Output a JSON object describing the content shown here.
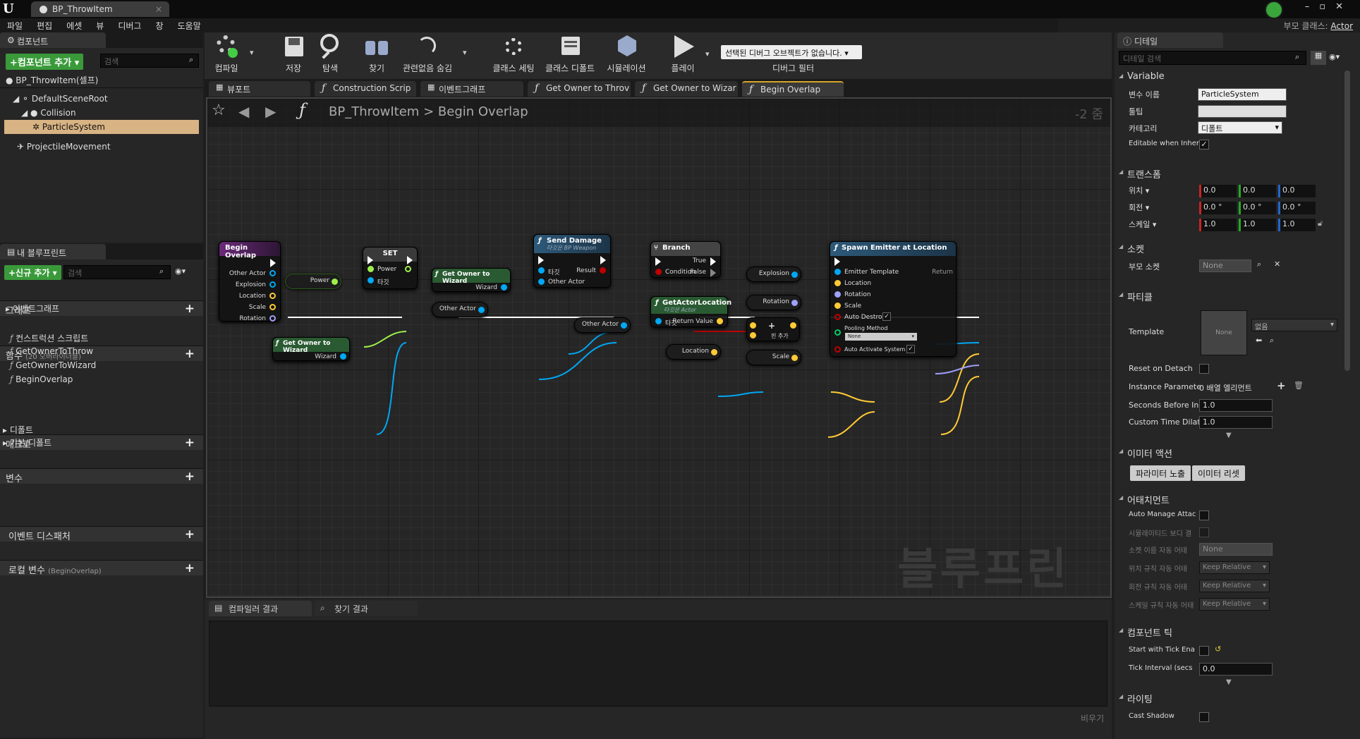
{
  "window": {
    "doc_tab": "BP_ThrowItem",
    "parent_class_label": "부모 클래스:",
    "parent_class_value": "Actor"
  },
  "menu": [
    "파일",
    "편집",
    "에셋",
    "뷰",
    "디버그",
    "창",
    "도움말"
  ],
  "components": {
    "title": "컴포넌트",
    "add_label": "+컴포넌트 추가 ▾",
    "search_placeholder": "검색",
    "self_item": "BP_ThrowItem(셀프)",
    "tree": [
      "DefaultSceneRoot",
      "Collision",
      "ParticleSystem",
      "ProjectileMovement"
    ]
  },
  "myblueprint": {
    "title": "내 블루프린트",
    "add_label": "+신규 추가 ▾",
    "search_placeholder": "검색",
    "graphs_label": "그래프",
    "eventgraph_label": "이벤트그래프",
    "functions_label": "함수",
    "functions_count": "(20 오버라이더블)",
    "functions": [
      "컨스트럭션 스크립트",
      "GetOwnerToThrow",
      "GetOwnerToWizard",
      "BeginOverlap"
    ],
    "macros_label": "매크로",
    "variables_label": "변수",
    "var_groups": [
      "디폴트",
      "기본/디폴트"
    ],
    "dispatchers_label": "이벤트 디스패처",
    "local_vars_label": "로컬 변수",
    "local_vars_scope": "(BeginOverlap)"
  },
  "toolbar": {
    "buttons": [
      "컴파일",
      "저장",
      "탐색",
      "찾기",
      "관련없음 숨김",
      "클래스 세팅",
      "클래스 디폴트",
      "시뮬레이션",
      "플레이"
    ],
    "debug_object": "선택된 디버그 오브젝트가 없습니다.",
    "debug_filter": "디버그 필터"
  },
  "graph_tabs": [
    "뷰포트",
    "Construction Scrip",
    "이벤트그래프",
    "Get Owner to Throv",
    "Get Owner to Wizar",
    "Begin Overlap"
  ],
  "breadcrumb": {
    "root": "BP_ThrowItem",
    "sep": ">",
    "leaf": "Begin Overlap",
    "zoom": "-2 줌"
  },
  "watermark": "블루프린트",
  "nodes": {
    "begin": {
      "title": "Begin Overlap",
      "pins": [
        "Other Actor",
        "Explosion",
        "Location",
        "Scale",
        "Rotation"
      ]
    },
    "set": {
      "title": "SET",
      "pins": [
        "Power",
        "타깃"
      ]
    },
    "power_var": "Power",
    "gotw1": {
      "title": "Get Owner to Wizard",
      "out": "Wizard"
    },
    "gotw2": {
      "title": "Get Owner to Wizard",
      "out": "Wizard"
    },
    "other_actor1": "Other Actor",
    "send": {
      "title": "Send Damage",
      "subtitle": "타깃은 BP Weapon",
      "pins": [
        "타깃",
        "Other Actor"
      ],
      "out": "Result"
    },
    "branch": {
      "title": "Branch",
      "cond": "Condition",
      "t": "True",
      "f": "False"
    },
    "gal": {
      "title": "GetActorLocation",
      "subtitle": "타깃은 Actor",
      "in": "타깃",
      "out": "Return Value"
    },
    "other_actor2": "Other Actor",
    "add": {
      "label": "핀 추가"
    },
    "location_var": "Location",
    "explosion_var": "Explosion",
    "rotation_var": "Rotation",
    "scale_var": "Scale",
    "spawn": {
      "title": "Spawn Emitter at Location",
      "pins": [
        "Emitter Template",
        "Location",
        "Rotation",
        "Scale",
        "Auto Destroy",
        "Pooling Method",
        "Auto Activate System"
      ],
      "pool_value": "None",
      "ret": "Return"
    }
  },
  "bottom": {
    "tabs": [
      "컴파일러 결과",
      "찾기 결과"
    ],
    "clear": "비우기"
  },
  "details": {
    "title": "디테일",
    "search_placeholder": "디테일 검색",
    "variable": {
      "header": "Variable",
      "name_label": "변수 이름",
      "name_value": "ParticleSystem",
      "tooltip_label": "툴팁",
      "category_label": "카테고리",
      "category_value": "디폴트",
      "editable_label": "Editable when Inher"
    },
    "transform": {
      "header": "트랜스폼",
      "location_label": "위치 ▾",
      "rotation_label": "회전 ▾",
      "scale_label": "스케일 ▾",
      "location": [
        "0.0",
        "0.0",
        "0.0"
      ],
      "rotation": [
        "0.0 °",
        "0.0 °",
        "0.0 °"
      ],
      "scale": [
        "1.0",
        "1.0",
        "1.0"
      ]
    },
    "sockets": {
      "header": "소켓",
      "parent_label": "부모 소켓",
      "parent_value": "None"
    },
    "particles": {
      "header": "파티클",
      "template_label": "Template",
      "template_thumb": "None",
      "template_value": "없음",
      "reset_label": "Reset on Detach",
      "instparam_label": "Instance Paramete",
      "instparam_value": "0 배열 엘리먼트",
      "seconds_label": "Seconds Before Ina",
      "seconds_value": "1.0",
      "dilation_label": "Custom Time Dilat",
      "dilation_value": "1.0"
    },
    "emitter_actions": {
      "header": "이미터 액션",
      "btn1": "파라미터 노출",
      "btn2": "이미터 리셋"
    },
    "attachment": {
      "header": "어태치먼트",
      "auto_manage": "Auto Manage Attac",
      "sim_body": "시뮬레이티드 보디 결",
      "socket_name_label": "소켓 이름 자동 어태",
      "socket_name_value": "None",
      "loc_rule_label": "위치 규칙 자동 어태",
      "rot_rule_label": "회전 규칙 자동 어태",
      "scale_rule_label": "스케일 규칙 자동 어태",
      "rule_value": "Keep Relative"
    },
    "tick": {
      "header": "컴포넌트 틱",
      "start_label": "Start with Tick Ena",
      "interval_label": "Tick Interval (secs",
      "interval_value": "0.0"
    },
    "lighting": {
      "header": "라이팅",
      "cast_shadow": "Cast Shadow"
    }
  },
  "colors": {
    "exec": "#ffffff",
    "object": "#00a8f4",
    "struct": "#ffca35",
    "bool": "#bf0000",
    "float": "#9df04a",
    "rotator": "#a0a0ff"
  }
}
